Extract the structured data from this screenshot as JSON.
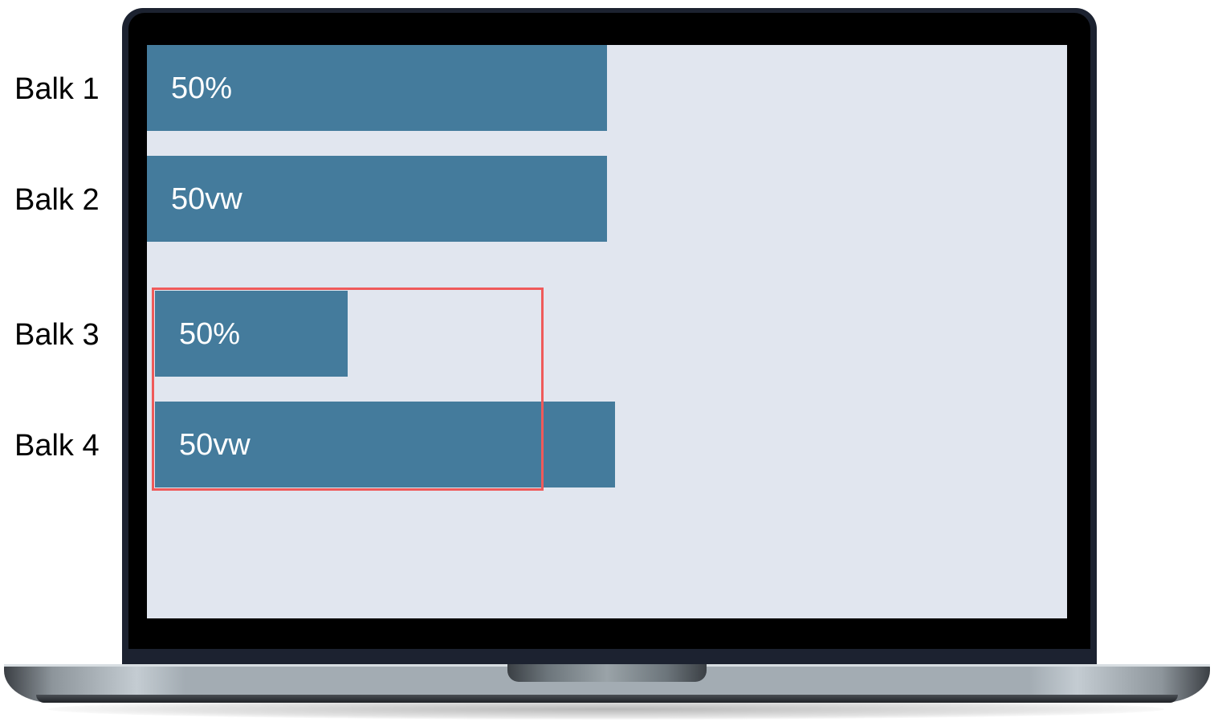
{
  "labels": [
    "Balk 1",
    "Balk 2",
    "Balk 3",
    "Balk 4"
  ],
  "bars": [
    {
      "name": "Balk 1",
      "text": "50%"
    },
    {
      "name": "Balk 2",
      "text": "50vw"
    },
    {
      "name": "Balk 3",
      "text": "50%"
    },
    {
      "name": "Balk 4",
      "text": "50vw"
    }
  ],
  "colors": {
    "bar": "#447b9c",
    "screen_bg": "#e1e6ef",
    "container_outline": "#ef5a5a",
    "bezel": "#000000",
    "laptop_frame": "#1c2230"
  }
}
